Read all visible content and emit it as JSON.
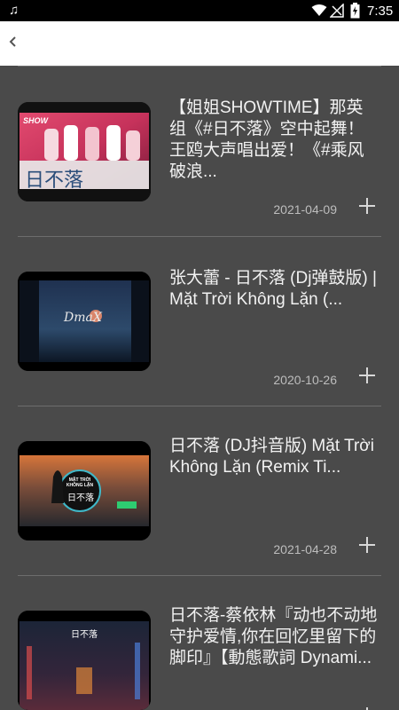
{
  "status_bar": {
    "time": "7:35",
    "left_icon": "music-note-icon",
    "right_icons": [
      "wifi-icon",
      "signal-icon",
      "battery-icon"
    ]
  },
  "app_bar": {
    "back_icon": "chevron-left-icon"
  },
  "videos": [
    {
      "title": "【姐姐SHOWTIME】那英组《#日不落》空中起舞！王鸥大声唱出爱！《#乘风破浪...",
      "date": "2021-04-09",
      "thumb_text": "日不落",
      "thumb_badge": "SHOW"
    },
    {
      "title": "张大蕾 - 日不落 (Dj弹鼓版) | Mặt Trời Không Lặn (...",
      "date": "2020-10-26",
      "thumb_text": "DmaX"
    },
    {
      "title": "日不落 (DJ抖音版) Mặt Trời Không Lặn (Remix Ti...",
      "date": "2021-04-28",
      "thumb_text": "日不落",
      "thumb_badge": "MẶT TRỜI KHÔNG LẶN"
    },
    {
      "title": "日不落-蔡依林『动也不动地守护爱情,你在回忆里留下的脚印』【動態歌詞 Dynami...",
      "date": "",
      "thumb_text": "日不落"
    }
  ]
}
